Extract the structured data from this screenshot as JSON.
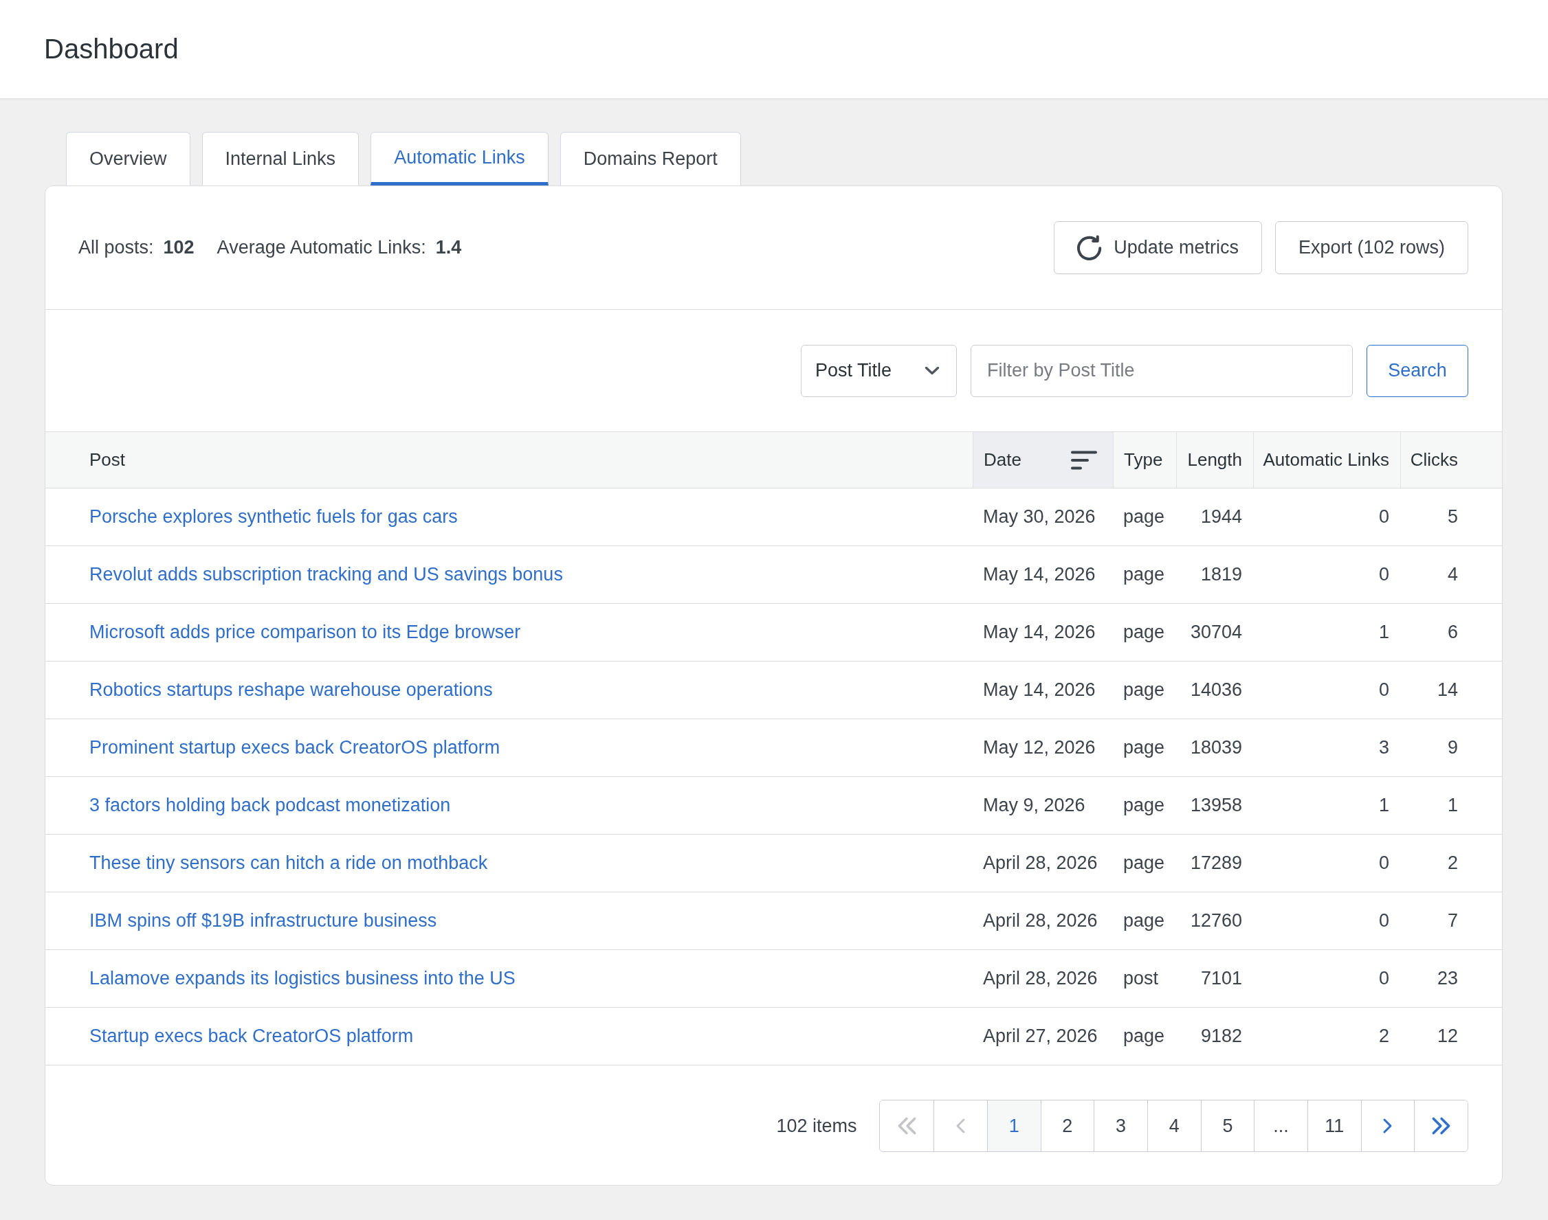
{
  "header": {
    "title": "Dashboard"
  },
  "tabs": [
    {
      "label": "Overview",
      "selected": false
    },
    {
      "label": "Internal Links",
      "selected": false
    },
    {
      "label": "Automatic Links",
      "selected": true
    },
    {
      "label": "Domains Report",
      "selected": false
    }
  ],
  "summary": {
    "stats": [
      {
        "label": "All posts:",
        "value": "102"
      },
      {
        "label": "Average Automatic Links:",
        "value": "1.4"
      }
    ],
    "buttons": [
      {
        "kind": "refresh",
        "label": "Update metrics"
      },
      {
        "kind": "export",
        "label": "Export (102 rows)"
      }
    ]
  },
  "filter": {
    "field": {
      "value": "Post Title"
    },
    "search": {
      "placeholder": "Filter by Post Title"
    },
    "button": "Search"
  },
  "table": {
    "columns": [
      {
        "label": "Post",
        "sorted": false
      },
      {
        "label": "Date",
        "sorted": true
      },
      {
        "label": "Type",
        "sorted": false
      },
      {
        "label": "Length",
        "sorted": false
      },
      {
        "label": "Automatic Links",
        "sorted": false
      },
      {
        "label": "Clicks",
        "sorted": false
      }
    ],
    "rows": [
      {
        "post": "Porsche explores synthetic fuels for gas cars",
        "date": "May 30, 2026",
        "type": "page",
        "length": "1944",
        "automatic_links": "0",
        "clicks": "5"
      },
      {
        "post": "Revolut adds subscription tracking and US savings bonus",
        "date": "May 14, 2026",
        "type": "page",
        "length": "1819",
        "automatic_links": "0",
        "clicks": "4"
      },
      {
        "post": "Microsoft adds price comparison to its Edge browser",
        "date": "May 14, 2026",
        "type": "page",
        "length": "30704",
        "automatic_links": "1",
        "clicks": "6"
      },
      {
        "post": "Robotics startups reshape warehouse operations",
        "date": "May 14, 2026",
        "type": "page",
        "length": "14036",
        "automatic_links": "0",
        "clicks": "14"
      },
      {
        "post": "Prominent startup execs back CreatorOS platform",
        "date": "May 12, 2026",
        "type": "page",
        "length": "18039",
        "automatic_links": "3",
        "clicks": "9"
      },
      {
        "post": "3 factors holding back podcast monetization",
        "date": "May 9, 2026",
        "type": "page",
        "length": "13958",
        "automatic_links": "1",
        "clicks": "1"
      },
      {
        "post": "These tiny sensors can hitch a ride on mothback",
        "date": "April 28, 2026",
        "type": "page",
        "length": "17289",
        "automatic_links": "0",
        "clicks": "2"
      },
      {
        "post": "IBM spins off $19B infrastructure business",
        "date": "April 28, 2026",
        "type": "page",
        "length": "12760",
        "automatic_links": "0",
        "clicks": "7"
      },
      {
        "post": "Lalamove expands its logistics business into the US",
        "date": "April 28, 2026",
        "type": "post",
        "length": "7101",
        "automatic_links": "0",
        "clicks": "23"
      },
      {
        "post": "Startup execs back CreatorOS platform",
        "date": "April 27, 2026",
        "type": "page",
        "length": "9182",
        "automatic_links": "2",
        "clicks": "12"
      }
    ]
  },
  "pagination": {
    "count": "102 items",
    "items": [
      {
        "kind": "first",
        "disabled": true
      },
      {
        "kind": "prev",
        "disabled": true
      },
      {
        "kind": "page",
        "label": "1",
        "selected": true
      },
      {
        "kind": "page",
        "label": "2",
        "selected": false
      },
      {
        "kind": "page",
        "label": "3",
        "selected": false
      },
      {
        "kind": "page",
        "label": "4",
        "selected": false
      },
      {
        "kind": "page",
        "label": "5",
        "selected": false
      },
      {
        "kind": "ellipsis",
        "label": "..."
      },
      {
        "kind": "page",
        "label": "11",
        "selected": false
      },
      {
        "kind": "next",
        "disabled": false
      },
      {
        "kind": "last",
        "disabled": false
      }
    ]
  }
}
